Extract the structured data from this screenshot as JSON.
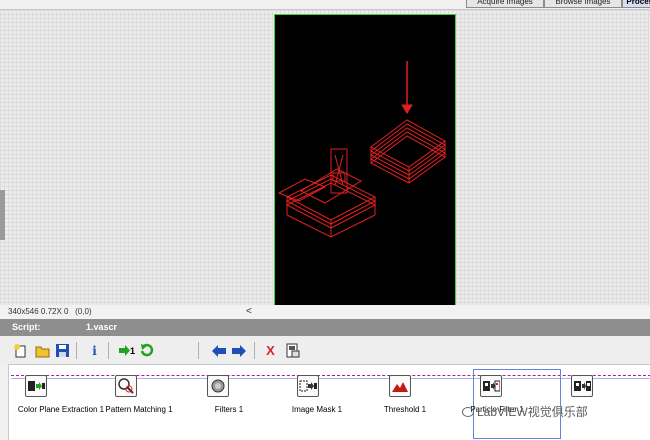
{
  "tabs": [
    {
      "label": "Acquire Images"
    },
    {
      "label": "Browse Images"
    },
    {
      "label": "Process"
    }
  ],
  "viewer": {
    "image_info": "340x546 0.72X 0",
    "cursor_coords": "(0,0)",
    "scroll_left_glyph": "<"
  },
  "script": {
    "label": "Script:",
    "filename": "1.vascr"
  },
  "toolbar": {
    "items": [
      {
        "icon": "new-script-icon"
      },
      {
        "icon": "open-script-icon"
      },
      {
        "icon": "save-script-icon"
      },
      {
        "icon": "info-icon",
        "glyph": "i"
      },
      {
        "icon": "run-once-icon",
        "glyph": "1"
      },
      {
        "icon": "run-continuous-icon"
      },
      {
        "icon": "move-left-icon"
      },
      {
        "icon": "move-right-icon"
      },
      {
        "icon": "delete-step-icon",
        "glyph": "X"
      },
      {
        "icon": "performance-meter-icon"
      }
    ]
  },
  "steps": [
    {
      "label": "Color Plane Extraction 1"
    },
    {
      "label": "Pattern Matching 1"
    },
    {
      "label": "Filters 1"
    },
    {
      "label": "Image Mask 1"
    },
    {
      "label": "Threshold 1"
    },
    {
      "label": "Particle Filter 1"
    },
    {
      "label": ""
    }
  ],
  "watermark": {
    "text": "LabVIEW视觉俱乐部"
  },
  "colors": {
    "accent_red": "#e02020",
    "frame_green": "#3ecf3e",
    "script_bar": "#8e8e8e",
    "flow_line": "#b41c8e"
  }
}
